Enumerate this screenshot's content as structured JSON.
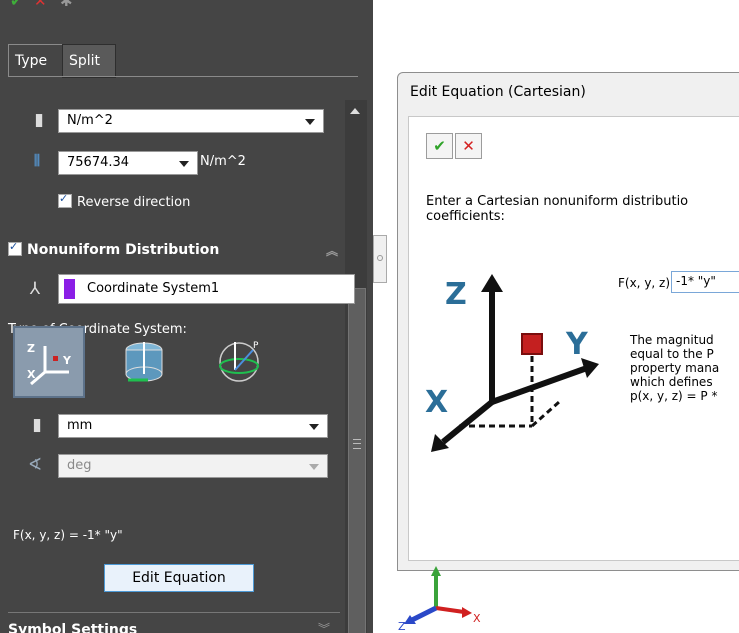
{
  "panel": {
    "tabs": [
      {
        "label": "Type"
      },
      {
        "label": "Split"
      }
    ],
    "pressure_unit": "N/m^2",
    "pressure_value": "75674.34",
    "pressure_value_unit": "N/m^2",
    "reverse_direction_label": "Reverse direction",
    "nonuniform_title": "Nonuniform Distribution",
    "coordinate_system": "Coordinate System1",
    "coord_type_label": "Type of Coordinate System:",
    "length_unit": "mm",
    "angle_unit": "deg",
    "equation_text": "F(x, y, z) = -1* \"y\"",
    "edit_equation_label": "Edit Equation",
    "symbol_settings_title": "Symbol Settings",
    "colors": {
      "panel_bg": "#454545",
      "swatch": "#8b1ee6",
      "button_border": "#4d9ad6"
    }
  },
  "dialog": {
    "title": "Edit Equation (Cartesian)",
    "ok_glyph": "✔",
    "cancel_glyph": "✕",
    "instruction_line1": "Enter a Cartesian nonuniform distributio",
    "instruction_line2": "coefficients:",
    "func_label": "F(x, y, z) =",
    "func_value": "-1* \"y\"",
    "desc_lines": [
      "The magnitud",
      "equal to the P",
      "property mana",
      "which defines",
      "p(x, y, z) = P *"
    ],
    "axis_labels": {
      "z": "Z",
      "y": "Y",
      "x": "X"
    }
  },
  "triad_labels": {
    "z": "Z",
    "x": "X"
  }
}
